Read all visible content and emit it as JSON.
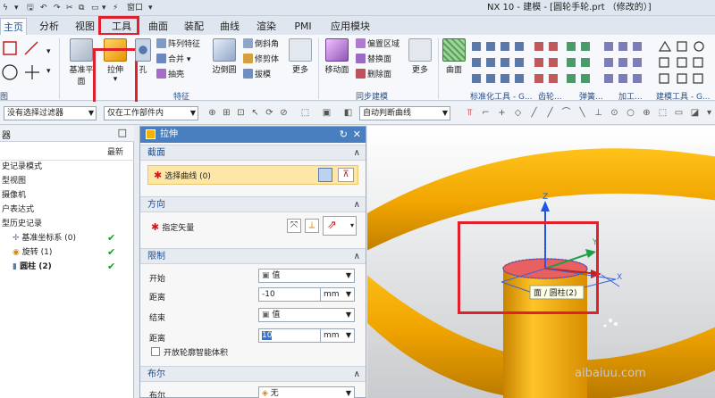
{
  "app": {
    "quick_access": [
      "ϟ",
      "▾",
      "🖫",
      "↶",
      "↷",
      "✂",
      "⧉",
      "▭",
      "▾",
      "⚡",
      "窗口",
      "▾"
    ],
    "window_title": "NX 10 - 建模 - [圆轮手轮.prt （修改的）]"
  },
  "tabs": [
    {
      "label": "主页",
      "active": true
    },
    {
      "label": "分析"
    },
    {
      "label": "视图"
    },
    {
      "label": "工具"
    },
    {
      "label": "曲面"
    },
    {
      "label": "装配"
    },
    {
      "label": "曲线"
    },
    {
      "label": "渲染"
    },
    {
      "label": "PMI"
    },
    {
      "label": "应用模块"
    }
  ],
  "ribbon": {
    "datum_plane": "基准平面",
    "extrude": "拉伸",
    "hole": "孔",
    "pattern_feature": "阵列特征",
    "unite": "合并",
    "shell": "抽壳",
    "edge_blend": "边倒圆",
    "chamfer": "倒斜角",
    "trim_body": "修剪体",
    "draft": "拔模",
    "more": "更多",
    "move_face": "移动面",
    "offset_region": "偏置区域",
    "replace_face": "替换面",
    "delete_face": "删除面",
    "surface": "曲面",
    "group_sketch": "图",
    "group_feature": "特征",
    "group_sync": "同步建模",
    "group_std": "标准化工具 - G...",
    "group_gear": "齿轮...",
    "group_spring": "弹簧...",
    "group_machining": "加工...",
    "group_build": "建模工具 - G..."
  },
  "filterbar": {
    "filter": "没有选择过滤器",
    "scope": "仅在工作部件内",
    "curve_rule": "自动判断曲线"
  },
  "navigator": {
    "title": "器",
    "col_latest": "最新",
    "rows": [
      {
        "label": "史记录模式",
        "check": false
      },
      {
        "label": "型视图",
        "check": false
      },
      {
        "label": "摄像机",
        "check": false
      },
      {
        "label": "户表达式",
        "check": false
      },
      {
        "label": "型历史记录",
        "check": false
      },
      {
        "label": "基准坐标系 (0)",
        "check": true
      },
      {
        "label": "旋转 (1)",
        "check": true
      },
      {
        "label": "圆柱 (2)",
        "check": true
      }
    ]
  },
  "dialog": {
    "title": "拉伸",
    "section_label": "截面",
    "select_curve": "选择曲线 (0)",
    "direction_label": "方向",
    "specify_vector": "指定矢量",
    "limits_label": "限制",
    "start_label": "开始",
    "start_value": "值",
    "distance1_label": "距离",
    "distance1_value": "-10",
    "distance1_unit": "mm",
    "end_label": "结束",
    "end_value": "值",
    "distance2_label": "距离",
    "distance2_value": "10",
    "distance2_unit": "mm",
    "open_profile": "开放轮廓智能体积",
    "boolean_section": "布尔",
    "boolean_label": "布尔",
    "boolean_value": "无"
  },
  "viewport": {
    "tooltip": "面 / 圆柱(2)",
    "axis_z": "Z",
    "axis_y": "Y",
    "axis_x": "X",
    "watermark": "aibaiuu.com"
  },
  "colors": {
    "accent": "#e0202a",
    "ring": "#f0a400",
    "title_bar": "#4a7fbf",
    "section_text": "#1f4d8f",
    "check": "#1e9a28"
  }
}
